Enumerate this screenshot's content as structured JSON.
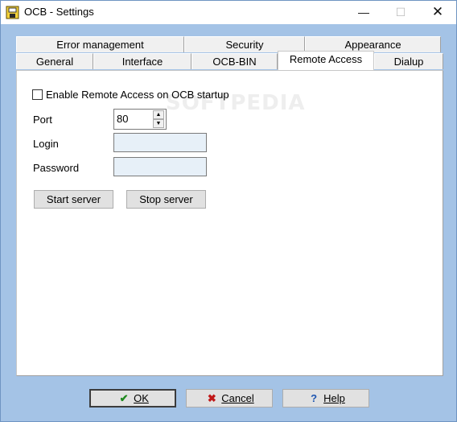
{
  "window": {
    "title": "OCB - Settings",
    "min_glyph": "—",
    "max_glyph": "☐",
    "close_glyph": "✕"
  },
  "tabs": {
    "row_back": [
      "Error management",
      "Security",
      "Appearance"
    ],
    "row_front": [
      "General",
      "Interface",
      "OCB-BIN",
      "Remote Access",
      "Dialup"
    ],
    "active": "Remote Access"
  },
  "remote_access": {
    "enable_label": "Enable Remote Access on OCB startup",
    "enable_checked": false,
    "port_label": "Port",
    "port_value": "80",
    "login_label": "Login",
    "login_value": "",
    "password_label": "Password",
    "password_value": "",
    "start_label": "Start server",
    "stop_label": "Stop server"
  },
  "watermark": "SOFTPEDIA",
  "footer": {
    "ok_label": "OK",
    "cancel_label": "Cancel",
    "help_label": "Help",
    "ok_icon": "check-icon",
    "cancel_icon": "cross-icon",
    "help_icon": "question-icon",
    "ok_color": "#1f8a1f",
    "cancel_color": "#c01818",
    "help_color": "#1f56b0"
  }
}
